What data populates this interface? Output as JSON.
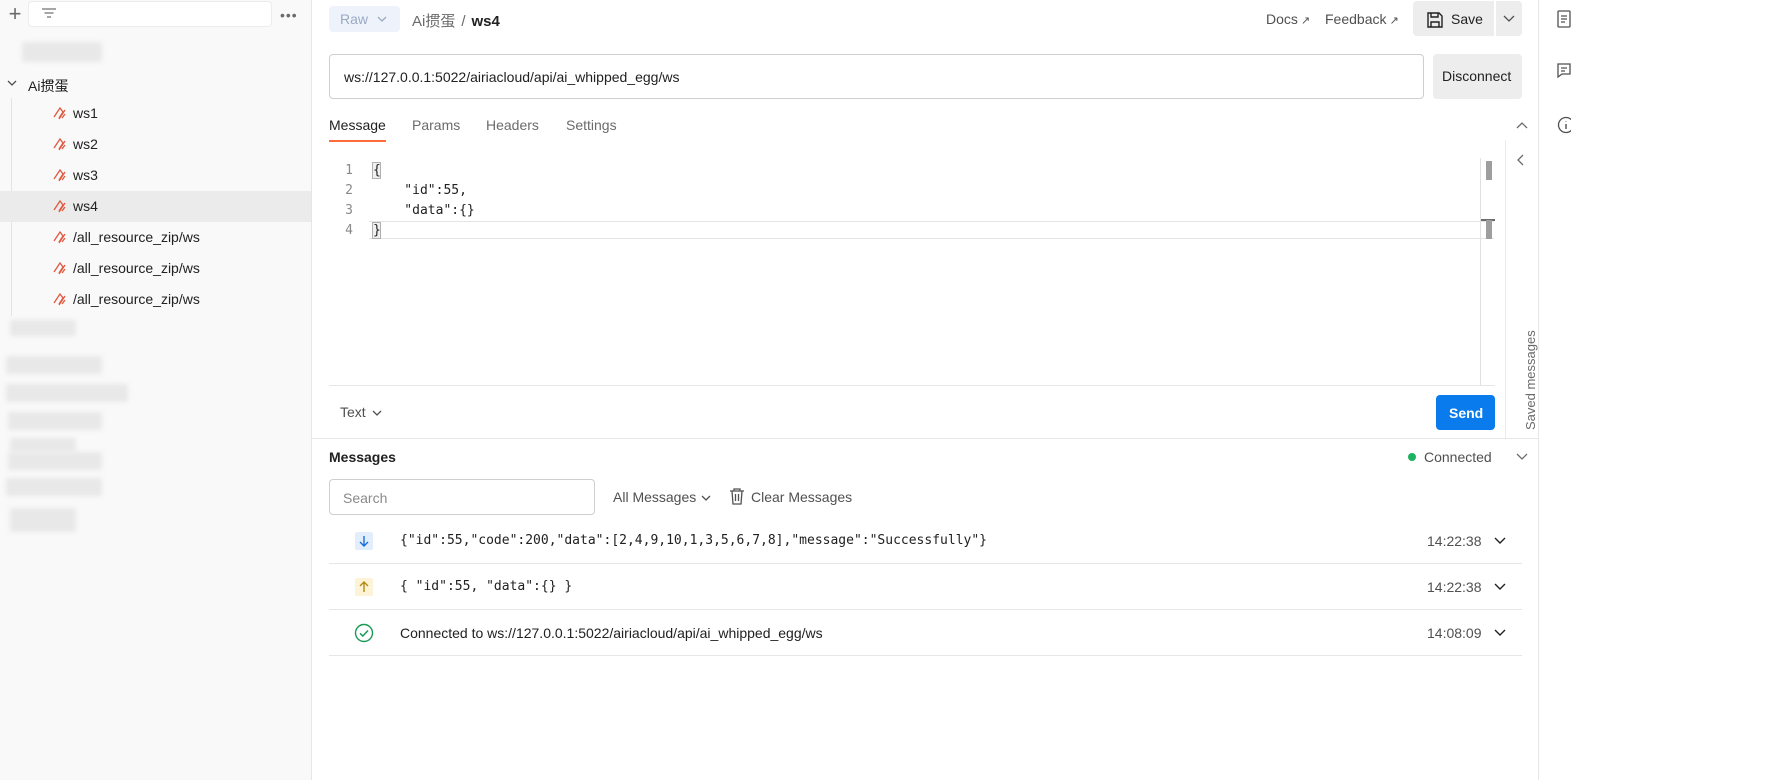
{
  "sidebar": {
    "folder_label": "Ai掼蛋",
    "items": [
      {
        "label": "ws1",
        "active": false
      },
      {
        "label": "ws2",
        "active": false
      },
      {
        "label": "ws3",
        "active": false
      },
      {
        "label": "ws4",
        "active": true
      },
      {
        "label": "/all_resource_zip/ws",
        "active": false
      },
      {
        "label": "/all_resource_zip/ws",
        "active": false
      },
      {
        "label": "/all_resource_zip/ws",
        "active": false
      }
    ]
  },
  "header": {
    "mode_label": "Raw",
    "breadcrumb_parent": "Ai掼蛋",
    "breadcrumb_separator": "/",
    "breadcrumb_current": "ws4",
    "docs_label": "Docs",
    "feedback_label": "Feedback",
    "external_glyph": "↗",
    "save_label": "Save"
  },
  "request": {
    "url": "ws://127.0.0.1:5022/airiacloud/api/ai_whipped_egg/ws",
    "disconnect_label": "Disconnect"
  },
  "tabs": [
    {
      "label": "Message",
      "active": true
    },
    {
      "label": "Params",
      "active": false
    },
    {
      "label": "Headers",
      "active": false
    },
    {
      "label": "Settings",
      "active": false
    }
  ],
  "editor": {
    "line_numbers": [
      "1",
      "2",
      "3",
      "4"
    ],
    "lines": [
      "{",
      "    \"id\":55,",
      "    \"data\":{}",
      "}"
    ]
  },
  "saved_messages_label": "Saved messages",
  "composer": {
    "format_label": "Text",
    "send_label": "Send"
  },
  "messages": {
    "title": "Messages",
    "status": "Connected",
    "status_color": "#1bb360",
    "search_placeholder": "Search",
    "filter_label": "All Messages",
    "clear_label": "Clear Messages",
    "rows": [
      {
        "direction": "incoming",
        "icon": "arrow-down-icon",
        "content": "{\"id\":55,\"code\":200,\"data\":[2,4,9,10,1,3,5,6,7,8],\"message\":\"Successfully\"}",
        "time": "14:22:38"
      },
      {
        "direction": "outgoing",
        "icon": "arrow-up-icon",
        "content": "{ \"id\":55, \"data\":{} }",
        "time": "14:22:38"
      },
      {
        "direction": "connected",
        "icon": "check-circle-icon",
        "content": "Connected to ws://127.0.0.1:5022/airiacloud/api/ai_whipped_egg/ws",
        "time": "14:08:09"
      }
    ]
  },
  "colors": {
    "accent": "#ff6c37",
    "primary_button": "#097bed",
    "request_icon": "#e0583e"
  }
}
